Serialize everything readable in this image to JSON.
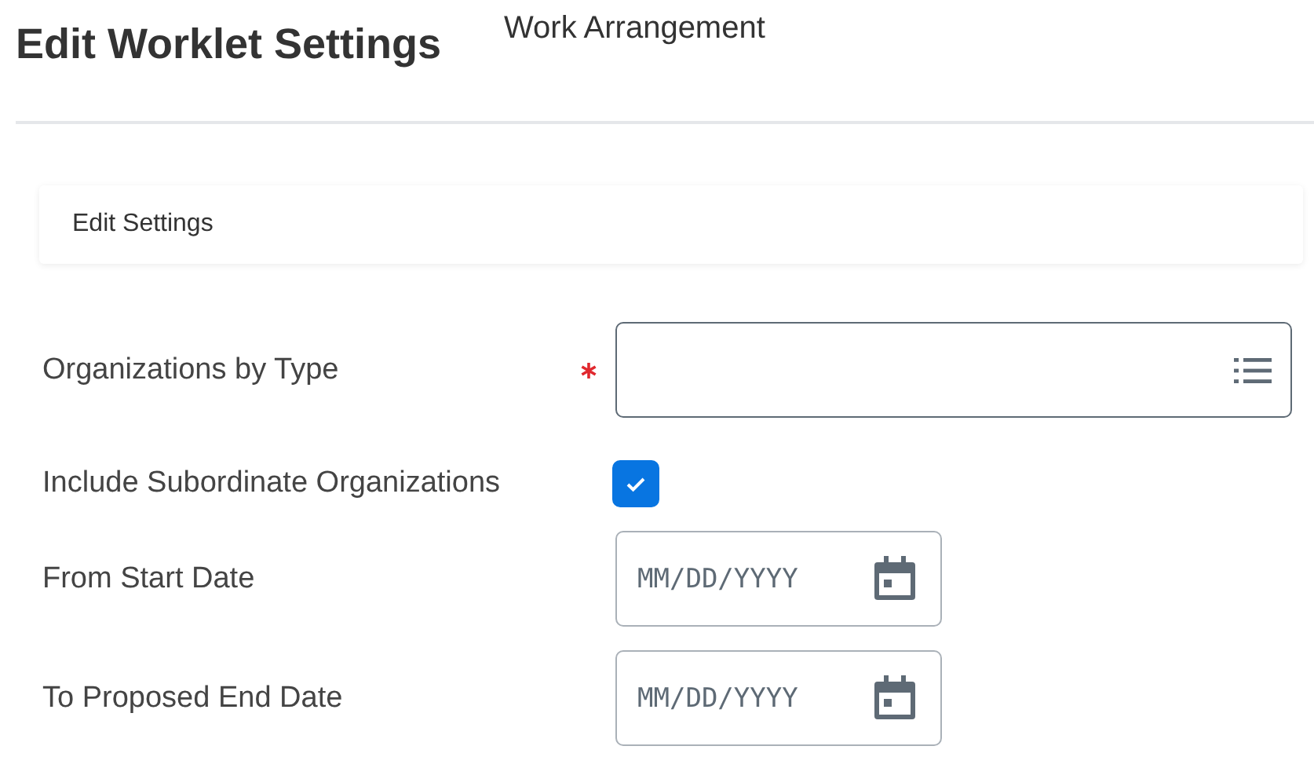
{
  "header": {
    "title": "Edit Worklet Settings",
    "subtitle": "Work Arrangement"
  },
  "section": {
    "title": "Edit Settings"
  },
  "fields": [
    {
      "kind": "prompt",
      "label": "Organizations by Type",
      "required": true
    },
    {
      "kind": "checkbox",
      "label": "Include Subordinate Organizations",
      "checked": true
    },
    {
      "kind": "date",
      "label": "From Start Date",
      "placeholder": "MM/DD/YYYY"
    },
    {
      "kind": "date",
      "label": "To Proposed End Date",
      "placeholder": "MM/DD/YYYY"
    }
  ]
}
